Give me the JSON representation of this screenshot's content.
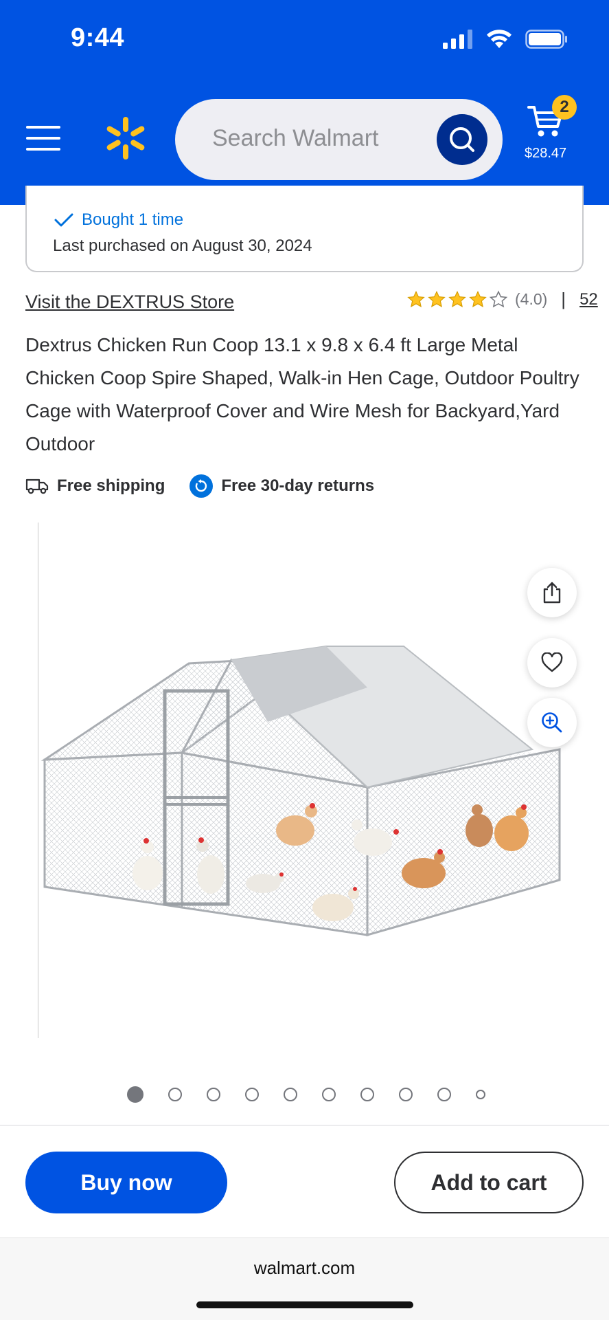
{
  "status_bar": {
    "time": "9:44"
  },
  "header": {
    "search": {
      "placeholder": "Search Walmart"
    },
    "cart": {
      "count": "2",
      "total": "$28.47"
    }
  },
  "purchase_history": {
    "bought_label": "Bought 1 time",
    "last_purchased": "Last purchased on August 30, 2024"
  },
  "product": {
    "store_link": "Visit the DEXTRUS Store",
    "rating": {
      "stars": 4.0,
      "value_label": "(4.0)",
      "separator": "|",
      "review_count": "52"
    },
    "title": "Dextrus Chicken Run Coop 13.1 x 9.8 x 6.4 ft Large Metal Chicken Coop Spire Shaped, Walk-in Hen Cage, Outdoor Poultry Cage with Waterproof Cover and Wire Mesh for Backyard,Yard Outdoor",
    "features": {
      "shipping": "Free shipping",
      "returns": "Free 30-day returns"
    },
    "gallery": {
      "total_images": 10,
      "active_index": 0
    }
  },
  "actions": {
    "buy_now": "Buy now",
    "add_to_cart": "Add to cart"
  },
  "browser": {
    "url": "walmart.com"
  },
  "colors": {
    "brand_blue": "#0053e2",
    "spark_yellow": "#ffc220",
    "link_blue": "#0071dc"
  }
}
